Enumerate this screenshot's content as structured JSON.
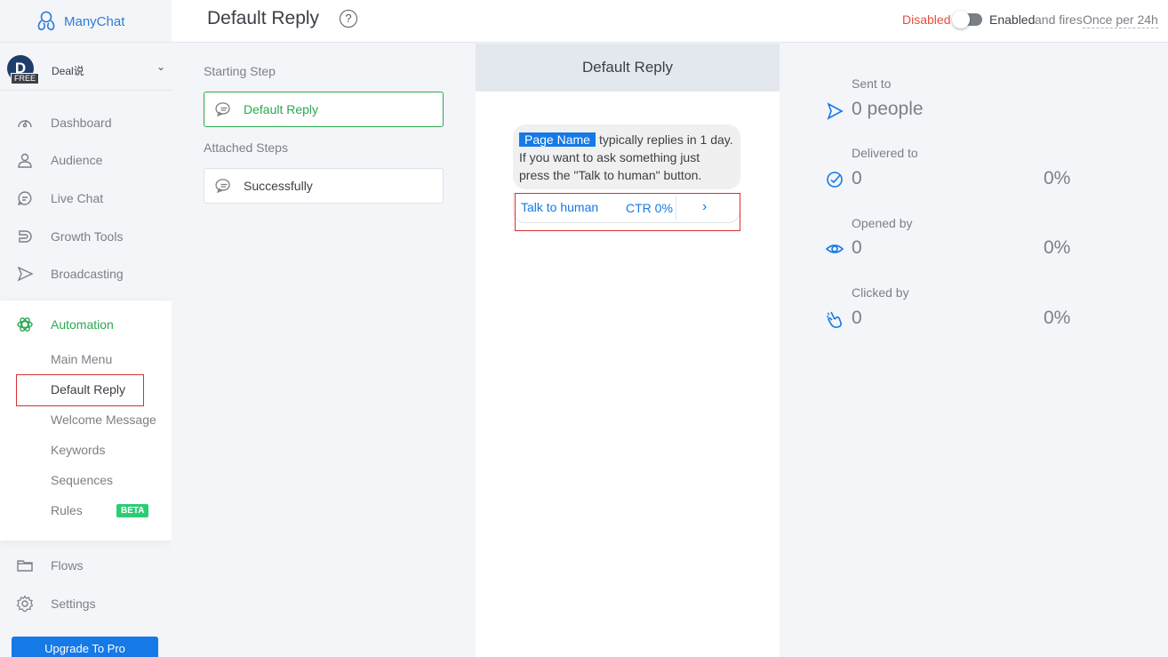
{
  "app": {
    "name": "ManyChat"
  },
  "account": {
    "avatar_letter": "D",
    "badge": "FREE",
    "name": "Deal说"
  },
  "nav": {
    "dashboard": "Dashboard",
    "audience": "Audience",
    "live_chat": "Live Chat",
    "growth_tools": "Growth Tools",
    "broadcasting": "Broadcasting",
    "automation": "Automation",
    "flows": "Flows",
    "settings": "Settings"
  },
  "automation_sub": {
    "main_menu": "Main Menu",
    "default_reply": "Default Reply",
    "welcome_message": "Welcome Message",
    "keywords": "Keywords",
    "sequences": "Sequences",
    "rules": "Rules",
    "rules_badge": "BETA"
  },
  "upgrade_label": "Upgrade To Pro",
  "header": {
    "title": "Default Reply",
    "help": "?",
    "status_disabled": "Disabled",
    "status_enabled": "Enabled",
    "fires_text": "and fires",
    "fires_value": "Once per 24h"
  },
  "steps": {
    "starting_label": "Starting Step",
    "starting_step": "Default Reply",
    "attached_label": "Attached Steps",
    "attached_step": "Successfully"
  },
  "preview": {
    "title": "Default Reply",
    "page_name": "Page Name",
    "message_1": "typically replies in 1 day.",
    "message_2": " If you want to ask something just press the \"Talk to human\" button.",
    "button_label": "Talk to human",
    "button_ctr": "CTR 0%",
    "chevron": "›"
  },
  "stats": {
    "sent_label": "Sent to",
    "sent_value": "0 people",
    "delivered_label": "Delivered to",
    "delivered_value": "0",
    "delivered_pct": "0%",
    "opened_label": "Opened by",
    "opened_value": "0",
    "opened_pct": "0%",
    "clicked_label": "Clicked by",
    "clicked_value": "0",
    "clicked_pct": "0%"
  },
  "colors": {
    "brand_blue": "#1579e6",
    "automation_green": "#2ca84f",
    "disabled_red": "#e74c3c",
    "beta_green": "#2ccc74"
  }
}
